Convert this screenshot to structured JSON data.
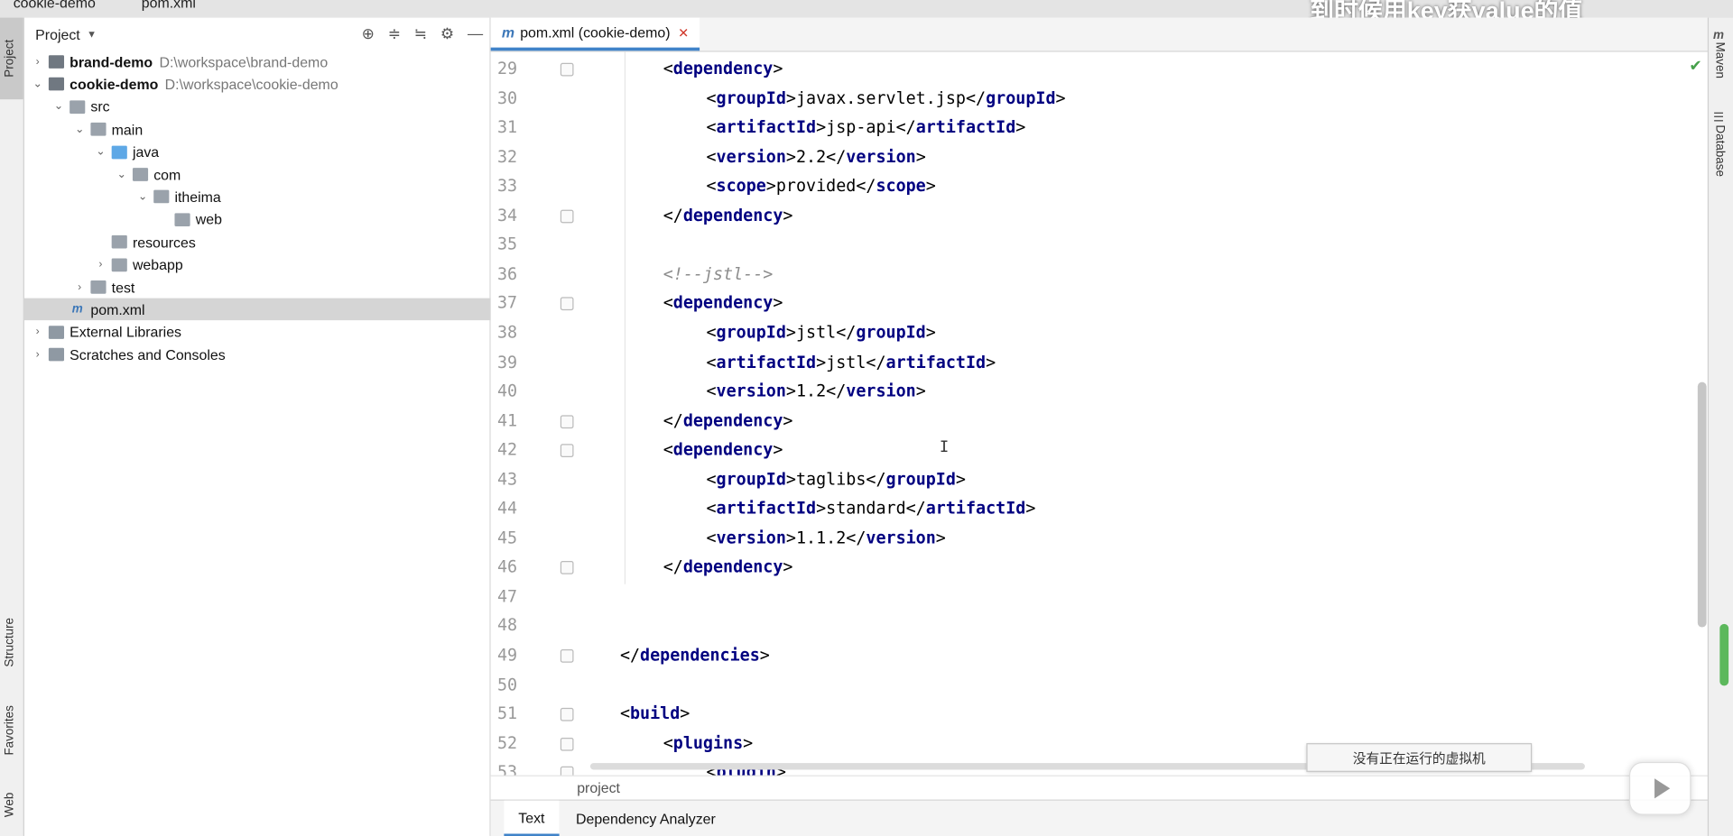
{
  "window": {
    "breadcrumb_project": "cookie-demo",
    "breadcrumb_file": "pom.xml",
    "video_overlay_text": "到时候用key获value的值"
  },
  "left_strip": {
    "tabs": [
      "Project",
      "Structure",
      "Favorites",
      "Web"
    ]
  },
  "right_strip": {
    "tabs": [
      "Maven",
      "Database"
    ]
  },
  "project_panel": {
    "title": "Project",
    "tools": [
      "target-icon",
      "expand-all-icon",
      "collapse-all-icon",
      "gear-icon",
      "hide-icon"
    ],
    "tree": [
      {
        "label": "brand-demo",
        "path": "D:\\workspace\\brand-demo",
        "bold": true,
        "depth": 0,
        "expand": "collapsed",
        "icon": "module-folder-icon"
      },
      {
        "label": "cookie-demo",
        "path": "D:\\workspace\\cookie-demo",
        "bold": true,
        "depth": 0,
        "expand": "expanded",
        "icon": "module-folder-icon"
      },
      {
        "label": "src",
        "path": "",
        "bold": false,
        "depth": 1,
        "expand": "expanded",
        "icon": "folder-icon"
      },
      {
        "label": "main",
        "path": "",
        "bold": false,
        "depth": 2,
        "expand": "expanded",
        "icon": "folder-icon"
      },
      {
        "label": "java",
        "path": "",
        "bold": false,
        "depth": 3,
        "expand": "expanded",
        "icon": "source-folder-icon"
      },
      {
        "label": "com",
        "path": "",
        "bold": false,
        "depth": 4,
        "expand": "expanded",
        "icon": "package-icon"
      },
      {
        "label": "itheima",
        "path": "",
        "bold": false,
        "depth": 5,
        "expand": "expanded",
        "icon": "package-icon"
      },
      {
        "label": "web",
        "path": "",
        "bold": false,
        "depth": 6,
        "expand": "none",
        "icon": "package-icon"
      },
      {
        "label": "resources",
        "path": "",
        "bold": false,
        "depth": 3,
        "expand": "none",
        "icon": "resources-folder-icon"
      },
      {
        "label": "webapp",
        "path": "",
        "bold": false,
        "depth": 3,
        "expand": "collapsed",
        "icon": "web-folder-icon"
      },
      {
        "label": "test",
        "path": "",
        "bold": false,
        "depth": 2,
        "expand": "collapsed",
        "icon": "folder-icon"
      },
      {
        "label": "pom.xml",
        "path": "",
        "bold": false,
        "depth": 1,
        "expand": "none",
        "icon": "maven-file-icon",
        "selected": true
      },
      {
        "label": "External Libraries",
        "path": "",
        "bold": false,
        "depth": 0,
        "expand": "collapsed",
        "icon": "libraries-icon"
      },
      {
        "label": "Scratches and Consoles",
        "path": "",
        "bold": false,
        "depth": 0,
        "expand": "collapsed",
        "icon": "scratches-icon"
      }
    ]
  },
  "editor": {
    "tab_label": "pom.xml (cookie-demo)",
    "tab_icon": "m",
    "lines": [
      {
        "n": 29,
        "indent": 2,
        "parts": [
          {
            "t": "br",
            "v": "<"
          },
          {
            "t": "tag",
            "v": "dependency"
          },
          {
            "t": "br",
            "v": ">"
          }
        ],
        "fold": true
      },
      {
        "n": 30,
        "indent": 3,
        "parts": [
          {
            "t": "br",
            "v": "<"
          },
          {
            "t": "tag",
            "v": "groupId"
          },
          {
            "t": "br",
            "v": ">javax.servlet.jsp</"
          },
          {
            "t": "tag",
            "v": "groupId"
          },
          {
            "t": "br",
            "v": ">"
          }
        ]
      },
      {
        "n": 31,
        "indent": 3,
        "parts": [
          {
            "t": "br",
            "v": "<"
          },
          {
            "t": "tag",
            "v": "artifactId"
          },
          {
            "t": "br",
            "v": ">jsp-api</"
          },
          {
            "t": "tag",
            "v": "artifactId"
          },
          {
            "t": "br",
            "v": ">"
          }
        ]
      },
      {
        "n": 32,
        "indent": 3,
        "parts": [
          {
            "t": "br",
            "v": "<"
          },
          {
            "t": "tag",
            "v": "version"
          },
          {
            "t": "br",
            "v": ">2.2</"
          },
          {
            "t": "tag",
            "v": "version"
          },
          {
            "t": "br",
            "v": ">"
          }
        ]
      },
      {
        "n": 33,
        "indent": 3,
        "parts": [
          {
            "t": "br",
            "v": "<"
          },
          {
            "t": "tag",
            "v": "scope"
          },
          {
            "t": "br",
            "v": ">provided</"
          },
          {
            "t": "tag",
            "v": "scope"
          },
          {
            "t": "br",
            "v": ">"
          }
        ]
      },
      {
        "n": 34,
        "indent": 2,
        "parts": [
          {
            "t": "br",
            "v": "</"
          },
          {
            "t": "tag",
            "v": "dependency"
          },
          {
            "t": "br",
            "v": ">"
          }
        ],
        "fold": true
      },
      {
        "n": 35,
        "indent": 0,
        "parts": []
      },
      {
        "n": 36,
        "indent": 2,
        "parts": [
          {
            "t": "comment",
            "v": "<!--jstl-->"
          }
        ]
      },
      {
        "n": 37,
        "indent": 2,
        "parts": [
          {
            "t": "br",
            "v": "<"
          },
          {
            "t": "tag",
            "v": "dependency"
          },
          {
            "t": "br",
            "v": ">"
          }
        ],
        "fold": true
      },
      {
        "n": 38,
        "indent": 3,
        "parts": [
          {
            "t": "br",
            "v": "<"
          },
          {
            "t": "tag",
            "v": "groupId"
          },
          {
            "t": "br",
            "v": ">jstl</"
          },
          {
            "t": "tag",
            "v": "groupId"
          },
          {
            "t": "br",
            "v": ">"
          }
        ]
      },
      {
        "n": 39,
        "indent": 3,
        "parts": [
          {
            "t": "br",
            "v": "<"
          },
          {
            "t": "tag",
            "v": "artifactId"
          },
          {
            "t": "br",
            "v": ">jstl</"
          },
          {
            "t": "tag",
            "v": "artifactId"
          },
          {
            "t": "br",
            "v": ">"
          }
        ]
      },
      {
        "n": 40,
        "indent": 3,
        "parts": [
          {
            "t": "br",
            "v": "<"
          },
          {
            "t": "tag",
            "v": "version"
          },
          {
            "t": "br",
            "v": ">1.2</"
          },
          {
            "t": "tag",
            "v": "version"
          },
          {
            "t": "br",
            "v": ">"
          }
        ]
      },
      {
        "n": 41,
        "indent": 2,
        "parts": [
          {
            "t": "br",
            "v": "</"
          },
          {
            "t": "tag",
            "v": "dependency"
          },
          {
            "t": "br",
            "v": ">"
          }
        ],
        "fold": true
      },
      {
        "n": 42,
        "indent": 2,
        "parts": [
          {
            "t": "br",
            "v": "<"
          },
          {
            "t": "tag",
            "v": "dependency"
          },
          {
            "t": "br",
            "v": ">"
          }
        ],
        "fold": true
      },
      {
        "n": 43,
        "indent": 3,
        "parts": [
          {
            "t": "br",
            "v": "<"
          },
          {
            "t": "tag",
            "v": "groupId"
          },
          {
            "t": "br",
            "v": ">taglibs</"
          },
          {
            "t": "tag",
            "v": "groupId"
          },
          {
            "t": "br",
            "v": ">"
          }
        ]
      },
      {
        "n": 44,
        "indent": 3,
        "parts": [
          {
            "t": "br",
            "v": "<"
          },
          {
            "t": "tag",
            "v": "artifactId"
          },
          {
            "t": "br",
            "v": ">standard</"
          },
          {
            "t": "tag",
            "v": "artifactId"
          },
          {
            "t": "br",
            "v": ">"
          }
        ]
      },
      {
        "n": 45,
        "indent": 3,
        "parts": [
          {
            "t": "br",
            "v": "<"
          },
          {
            "t": "tag",
            "v": "version"
          },
          {
            "t": "br",
            "v": ">1.1.2</"
          },
          {
            "t": "tag",
            "v": "version"
          },
          {
            "t": "br",
            "v": ">"
          }
        ]
      },
      {
        "n": 46,
        "indent": 2,
        "parts": [
          {
            "t": "br",
            "v": "</"
          },
          {
            "t": "tag",
            "v": "dependency"
          },
          {
            "t": "br",
            "v": ">"
          }
        ],
        "fold": true
      },
      {
        "n": 47,
        "indent": 0,
        "parts": []
      },
      {
        "n": 48,
        "indent": 0,
        "parts": []
      },
      {
        "n": 49,
        "indent": 1,
        "parts": [
          {
            "t": "br",
            "v": "</"
          },
          {
            "t": "tag",
            "v": "dependencies"
          },
          {
            "t": "br",
            "v": ">"
          }
        ],
        "fold": true
      },
      {
        "n": 50,
        "indent": 0,
        "parts": []
      },
      {
        "n": 51,
        "indent": 1,
        "parts": [
          {
            "t": "br",
            "v": "<"
          },
          {
            "t": "tag",
            "v": "build"
          },
          {
            "t": "br",
            "v": ">"
          }
        ],
        "fold": true
      },
      {
        "n": 52,
        "indent": 2,
        "parts": [
          {
            "t": "br",
            "v": "<"
          },
          {
            "t": "tag",
            "v": "plugins"
          },
          {
            "t": "br",
            "v": ">"
          }
        ],
        "fold": true
      },
      {
        "n": 53,
        "indent": 3,
        "parts": [
          {
            "t": "br",
            "v": "<"
          },
          {
            "t": "tag",
            "v": "plugin"
          },
          {
            "t": "br",
            "v": ">"
          }
        ],
        "fold": true
      }
    ],
    "breadcrumb": "project",
    "bottom_tabs": [
      {
        "label": "Text",
        "active": true
      },
      {
        "label": "Dependency Analyzer",
        "active": false
      }
    ]
  },
  "tooltip": "没有正在运行的虚拟机",
  "colors": {
    "tag": "#000080",
    "comment": "#8c8c8c",
    "accent": "#4083c9",
    "selection": "#d5d5d5"
  }
}
